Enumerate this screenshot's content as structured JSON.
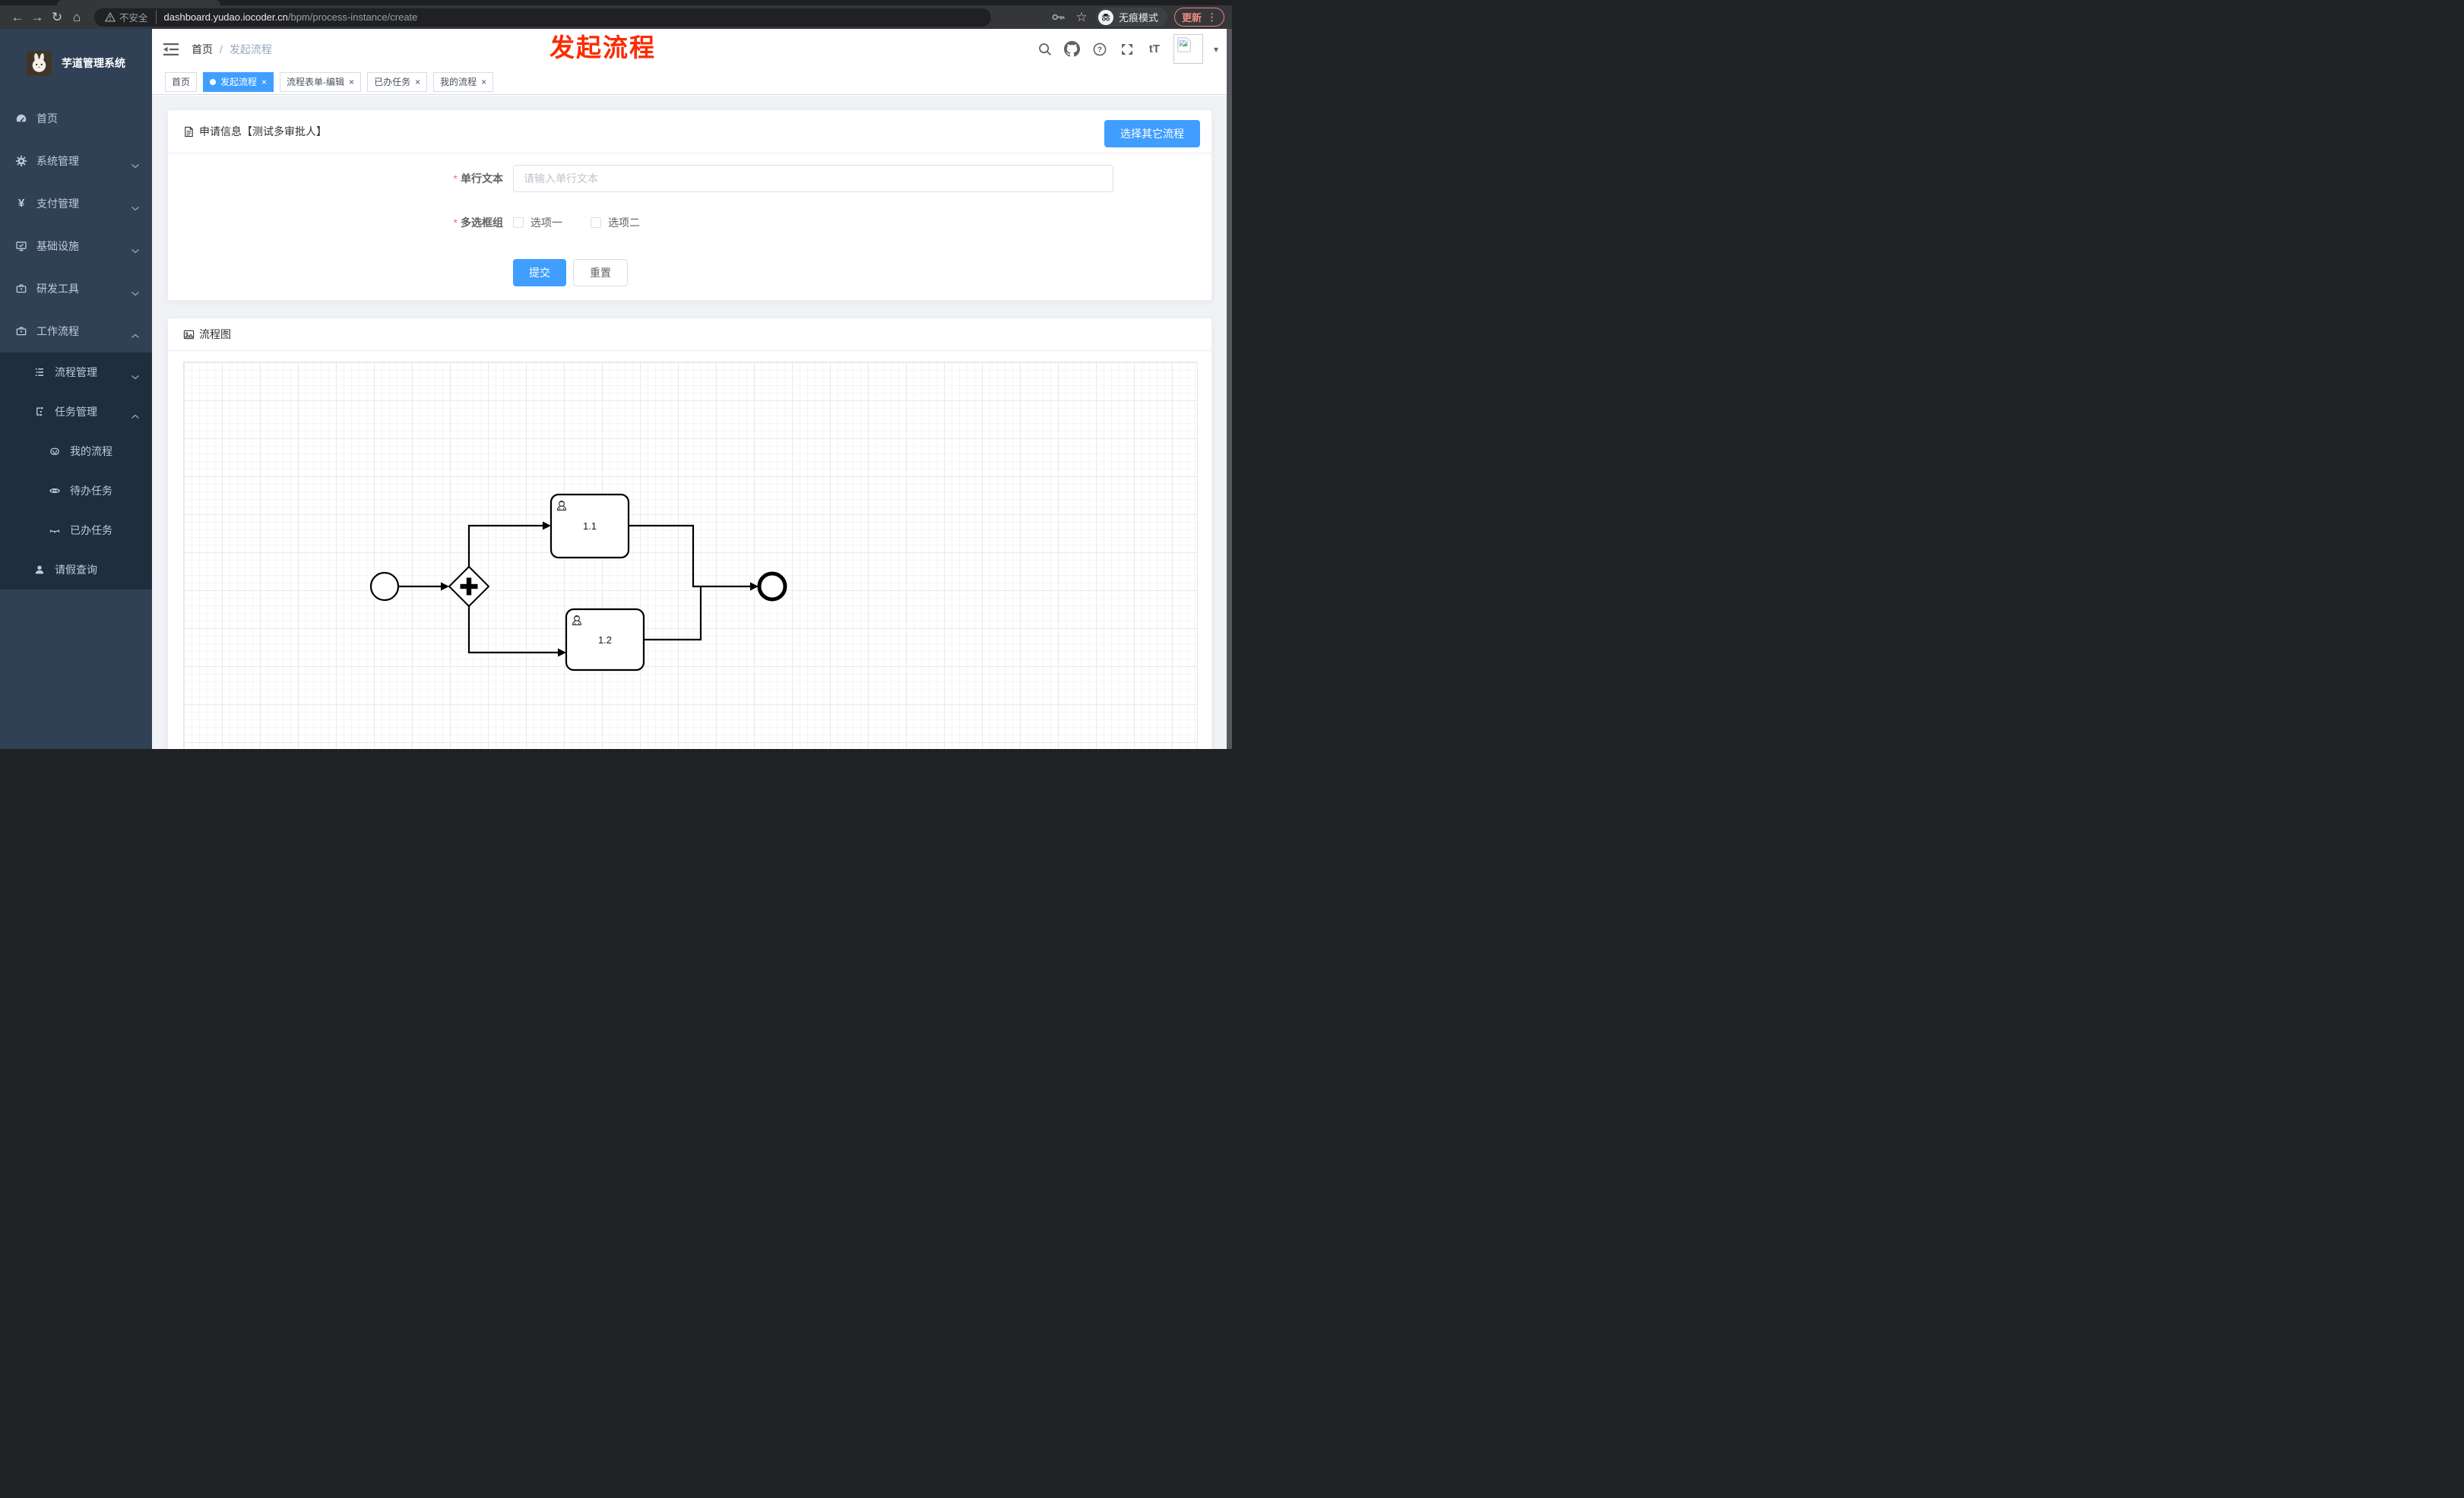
{
  "browser": {
    "security_label": "不安全",
    "url_host": "dashboard.yudao.iocoder.cn",
    "url_path": "/bpm/process-instance/create",
    "incognito_label": "无痕模式",
    "update_label": "更新"
  },
  "glyphs": {
    "back": "←",
    "forward": "→",
    "reload": "↻",
    "home": "⌂",
    "star": "☆",
    "dots": "⋮",
    "close": "×",
    "slash": "/",
    "caret": "▾",
    "yen": "¥",
    "font_size": "tT",
    "question": "?"
  },
  "annotation": {
    "text": "发起流程"
  },
  "sidebar": {
    "title": "芋道管理系统",
    "items": [
      {
        "label": "首页"
      },
      {
        "label": "系统管理"
      },
      {
        "label": "支付管理"
      },
      {
        "label": "基础设施"
      },
      {
        "label": "研发工具"
      },
      {
        "label": "工作流程"
      },
      {
        "label": "流程管理"
      },
      {
        "label": "任务管理"
      },
      {
        "label": "我的流程"
      },
      {
        "label": "待办任务"
      },
      {
        "label": "已办任务"
      },
      {
        "label": "请假查询"
      }
    ]
  },
  "breadcrumb": {
    "home": "首页",
    "current": "发起流程"
  },
  "tabs": {
    "items": [
      {
        "label": "首页",
        "active": false,
        "closable": false
      },
      {
        "label": "发起流程",
        "active": true,
        "closable": true
      },
      {
        "label": "流程表单-编辑",
        "active": false,
        "closable": true
      },
      {
        "label": "已办任务",
        "active": false,
        "closable": true
      },
      {
        "label": "我的流程",
        "active": false,
        "closable": true
      }
    ]
  },
  "form_card": {
    "title": "申请信息【测试多审批人】",
    "choose_button": "选择其它流程",
    "text_field": {
      "label": "单行文本",
      "placeholder": "请输入单行文本"
    },
    "checkbox_field": {
      "label": "多选框组",
      "options": [
        {
          "label": "选项一"
        },
        {
          "label": "选项二"
        }
      ]
    },
    "submit_label": "提交",
    "reset_label": "重置"
  },
  "diagram_card": {
    "title": "流程图",
    "nodes": {
      "task1": "1.1",
      "task2": "1.2"
    }
  },
  "colors": {
    "primary": "#409eff",
    "annotation_red": "#fb2b00",
    "sidebar_bg": "#304156",
    "submenu_bg": "#1f2d3d",
    "active_tab": "#409eff"
  }
}
